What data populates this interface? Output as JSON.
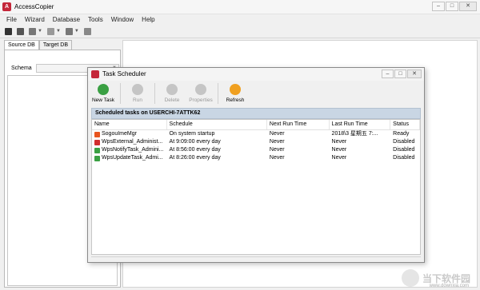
{
  "window": {
    "title": "AccessCopier",
    "app_icon": "accesscopier-icon"
  },
  "menu": [
    "File",
    "Wizard",
    "Database",
    "Tools",
    "Window",
    "Help"
  ],
  "left_pane": {
    "tabs": [
      "Source DB",
      "Target DB"
    ],
    "schema_label": "Schema",
    "schema_value": ""
  },
  "dialog": {
    "title": "Task Scheduler",
    "toolbar": [
      {
        "label": "New Task",
        "enabled": true,
        "icon": "new-task-icon",
        "color": "#3aa043"
      },
      {
        "label": "Run",
        "enabled": false,
        "icon": "run-icon",
        "color": "#c5c5c5"
      },
      {
        "label": "Delete",
        "enabled": false,
        "icon": "delete-icon",
        "color": "#c5c5c5"
      },
      {
        "label": "Properties",
        "enabled": false,
        "icon": "properties-icon",
        "color": "#c5c5c5"
      },
      {
        "label": "Refresh",
        "enabled": true,
        "icon": "refresh-icon",
        "color": "#f0a020"
      }
    ],
    "section_title": "Scheduled tasks on USERCHI-7ATTK62",
    "columns": [
      "Name",
      "Schedule",
      "Next Run Time",
      "Last Run Time",
      "Status"
    ],
    "rows": [
      {
        "name": "SogouImeMgr",
        "schedule": "On system startup",
        "next": "Never",
        "last": "2018\\3 星期五 7:...",
        "status": "Ready",
        "icon_color": "#e8541e"
      },
      {
        "name": "WpsExternal_Administ...",
        "schedule": "At 9:09:00 every day",
        "next": "Never",
        "last": "Never",
        "status": "Disabled",
        "icon_color": "#d12e2e"
      },
      {
        "name": "WpsNotifyTask_Admini...",
        "schedule": "At 8:56:00 every day",
        "next": "Never",
        "last": "Never",
        "status": "Disabled",
        "icon_color": "#3aa043"
      },
      {
        "name": "WpsUpdateTask_Admi...",
        "schedule": "At 8:26:00 every day",
        "next": "Never",
        "last": "Never",
        "status": "Disabled",
        "icon_color": "#3aa043"
      }
    ]
  },
  "watermark": {
    "text": "当下软件园",
    "url": "www.downxia.com"
  }
}
